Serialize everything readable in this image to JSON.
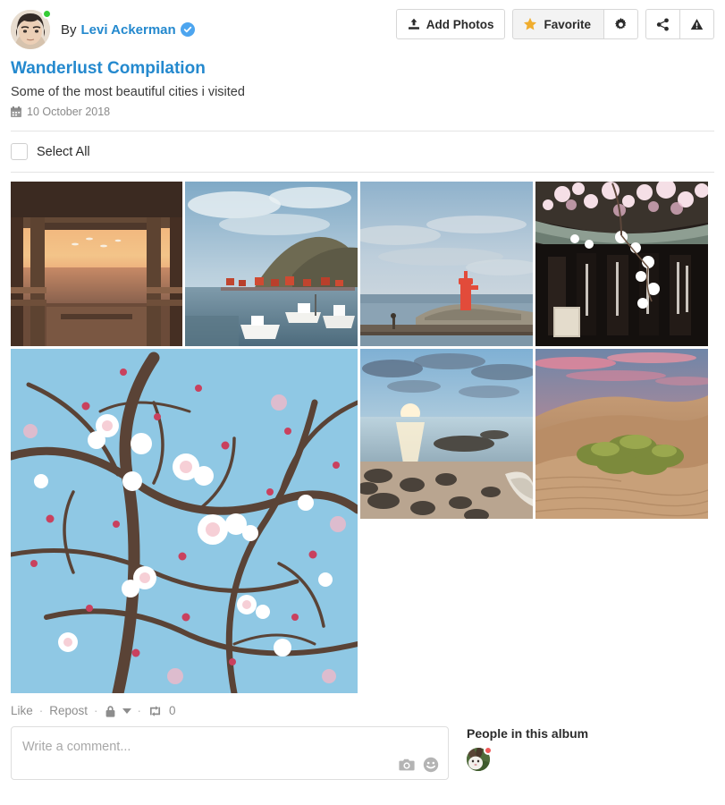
{
  "header": {
    "by_label": "By",
    "author_name": "Levi Ackerman",
    "verified_icon": "verified-badge-icon",
    "avatar_icon": "user-avatar",
    "presence_status": "online"
  },
  "toolbar": {
    "add_photos_label": "Add Photos",
    "add_photos_icon": "upload-icon",
    "favorite_label": "Favorite",
    "favorite_icon": "star-icon",
    "settings_icon": "gear-icon",
    "share_icon": "share-icon",
    "report_icon": "warning-icon"
  },
  "album": {
    "title": "Wanderlust Compilation",
    "description": "Some of the most beautiful cities i visited",
    "date": "10 October 2018",
    "date_icon": "calendar-icon"
  },
  "select_all": {
    "label": "Select All",
    "checked": false
  },
  "photos": [
    {
      "id": "photo-1",
      "alt": "Wooden pier pavilion at sunset with birds over the sea"
    },
    {
      "id": "photo-2",
      "alt": "Coastal fishing village with boats and mountain"
    },
    {
      "id": "photo-3",
      "alt": "Red lighthouse on a rocky breakwater"
    },
    {
      "id": "photo-4",
      "alt": "Cherry blossoms over a temple roof with hanging banners"
    },
    {
      "id": "photo-5",
      "alt": "Cherry blossom branches against a blue sky"
    },
    {
      "id": "photo-6",
      "alt": "Rocky beach at sunset with a boat"
    },
    {
      "id": "photo-7",
      "alt": "Sand dune with green shrub at dusk"
    }
  ],
  "actions": {
    "like_label": "Like",
    "repost_label": "Repost",
    "privacy_icon": "lock-icon",
    "privacy_caret_icon": "chevron-down-icon",
    "repost_icon": "repost-icon",
    "repost_count": "0",
    "separator": "·"
  },
  "comment": {
    "value": "",
    "placeholder": "Write a comment...",
    "camera_icon": "camera-icon",
    "emoji_icon": "smiley-icon"
  },
  "people": {
    "title": "People in this album",
    "members": [
      {
        "name": "person-1",
        "avatar_icon": "rabbit-avatar",
        "status": "busy"
      }
    ]
  },
  "colors": {
    "link": "#2489ce",
    "star": "#f0ad2e",
    "online": "#36cc36",
    "busy": "#f05a5a",
    "verified": "#4da5ef",
    "muted": "#8d8d8d"
  }
}
